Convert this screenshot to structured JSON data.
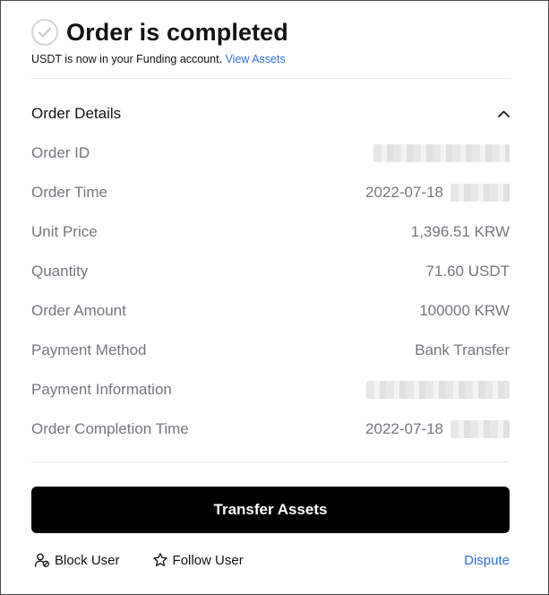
{
  "header": {
    "title": "Order is completed",
    "subtitle_text": "USDT is now in your Funding account.",
    "view_assets_link": "View Assets"
  },
  "details": {
    "section_title": "Order Details",
    "rows": [
      {
        "label": "Order ID",
        "value": ""
      },
      {
        "label": "Order Time",
        "value": "2022-07-18"
      },
      {
        "label": "Unit Price",
        "value": "1,396.51 KRW"
      },
      {
        "label": "Quantity",
        "value": "71.60 USDT"
      },
      {
        "label": "Order Amount",
        "value": "100000 KRW"
      },
      {
        "label": "Payment Method",
        "value": "Bank Transfer"
      },
      {
        "label": "Payment Information",
        "value": ""
      },
      {
        "label": "Order Completion Time",
        "value": "2022-07-18"
      }
    ]
  },
  "actions": {
    "primary_button": "Transfer Assets",
    "block_user": "Block User",
    "follow_user": "Follow User",
    "dispute": "Dispute"
  },
  "colors": {
    "accent": "#2f6fde",
    "primary_button_bg": "#000000",
    "muted_text": "#76767e"
  },
  "icons": [
    "check-circle-icon",
    "chevron-up-icon",
    "block-user-icon",
    "star-outline-icon"
  ]
}
